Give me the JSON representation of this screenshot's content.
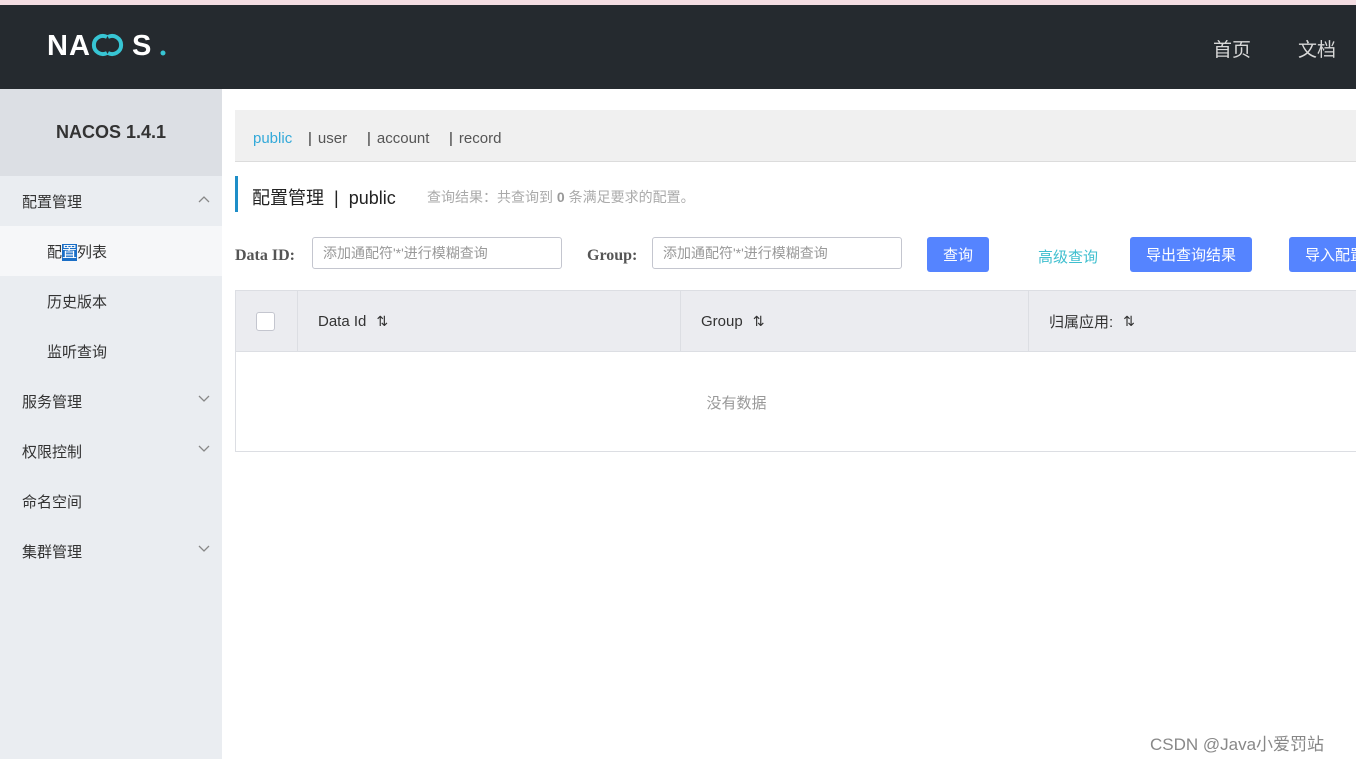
{
  "header": {
    "logo_text": "NACOS.",
    "nav": [
      "首页",
      "文档"
    ]
  },
  "sidebar": {
    "version": "NACOS 1.4.1",
    "items": [
      {
        "label": "配置管理",
        "icon": "chevron-up-icon"
      },
      {
        "label_pre": "配",
        "label_hl": "置",
        "label_post": "列表"
      },
      {
        "label": "历史版本"
      },
      {
        "label": "监听查询"
      },
      {
        "label": "服务管理",
        "icon": "chevron-down-icon"
      },
      {
        "label": "权限控制",
        "icon": "chevron-down-icon"
      },
      {
        "label": "命名空间"
      },
      {
        "label": "集群管理",
        "icon": "chevron-down-icon"
      }
    ]
  },
  "namespaces": [
    "public",
    "user",
    "account",
    "record"
  ],
  "page": {
    "title": "配置管理",
    "separator": "|",
    "namespace": "public",
    "result_prefix": "查询结果：共查询到",
    "result_count": "0",
    "result_suffix": "条满足要求的配置。"
  },
  "search": {
    "dataid_label": "Data ID:",
    "dataid_placeholder": "添加通配符'*'进行模糊查询",
    "group_label": "Group:",
    "group_placeholder": "添加通配符'*'进行模糊查询",
    "query_button": "查询",
    "advanced_link": "高级查询",
    "export_button": "导出查询结果",
    "import_button": "导入配置"
  },
  "table": {
    "columns": [
      "Data Id",
      "Group",
      "归属应用:"
    ],
    "empty_text": "没有数据"
  },
  "watermark": "CSDN @Java小爱罚站",
  "colors": {
    "header_bg": "#252a2f",
    "primary": "#5584ff",
    "link": "#3fbfcf",
    "active_ns": "#33a9d9"
  }
}
